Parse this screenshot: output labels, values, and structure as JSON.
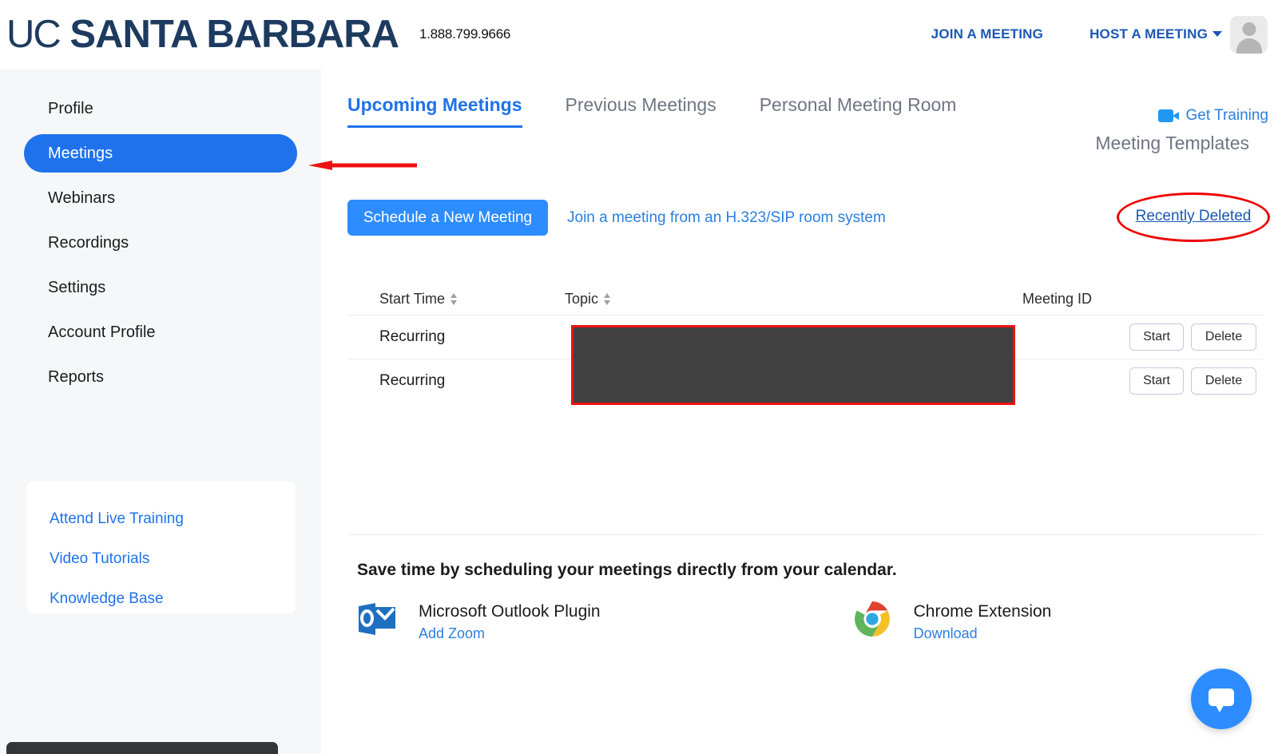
{
  "header": {
    "logo_uc": "UC",
    "logo_name": "SANTA BARBARA",
    "phone": "1.888.799.9666",
    "join_meeting": "JOIN A MEETING",
    "host_meeting": "HOST A MEETING",
    "avatar_name": "user-avatar"
  },
  "sidebar": {
    "items": [
      {
        "label": "Profile",
        "active": false
      },
      {
        "label": "Meetings",
        "active": true
      },
      {
        "label": "Webinars",
        "active": false
      },
      {
        "label": "Recordings",
        "active": false
      },
      {
        "label": "Settings",
        "active": false
      },
      {
        "label": "Account Profile",
        "active": false
      },
      {
        "label": "Reports",
        "active": false
      }
    ],
    "help_links": [
      "Attend Live Training",
      "Video Tutorials",
      "Knowledge Base"
    ]
  },
  "main": {
    "tabs": [
      {
        "label": "Upcoming Meetings",
        "active": true
      },
      {
        "label": "Previous Meetings",
        "active": false
      },
      {
        "label": "Personal Meeting Room",
        "active": false
      }
    ],
    "get_training": "Get Training",
    "meeting_templates": "Meeting Templates",
    "schedule_button": "Schedule a New Meeting",
    "join_h323": "Join a meeting from an H.323/SIP room system",
    "recently_deleted": "Recently Deleted",
    "table": {
      "columns": {
        "start_time": "Start Time",
        "topic": "Topic",
        "meeting_id": "Meeting ID"
      },
      "rows": [
        {
          "start_time": "Recurring",
          "topic": "",
          "meeting_id": "",
          "start_label": "Start",
          "delete_label": "Delete"
        },
        {
          "start_time": "Recurring",
          "topic": "",
          "meeting_id": "",
          "start_label": "Start",
          "delete_label": "Delete"
        }
      ]
    },
    "promo": {
      "title": "Save time by scheduling your meetings directly from your calendar.",
      "outlook_name": "Microsoft Outlook Plugin",
      "outlook_action": "Add Zoom",
      "chrome_name": "Chrome Extension",
      "chrome_action": "Download"
    }
  },
  "colors": {
    "brand_navy": "#1d3a5f",
    "accent_blue": "#2d8cff",
    "link_blue": "#2a7fe0",
    "annotation_red": "#ee0000",
    "redaction": "#414141"
  }
}
